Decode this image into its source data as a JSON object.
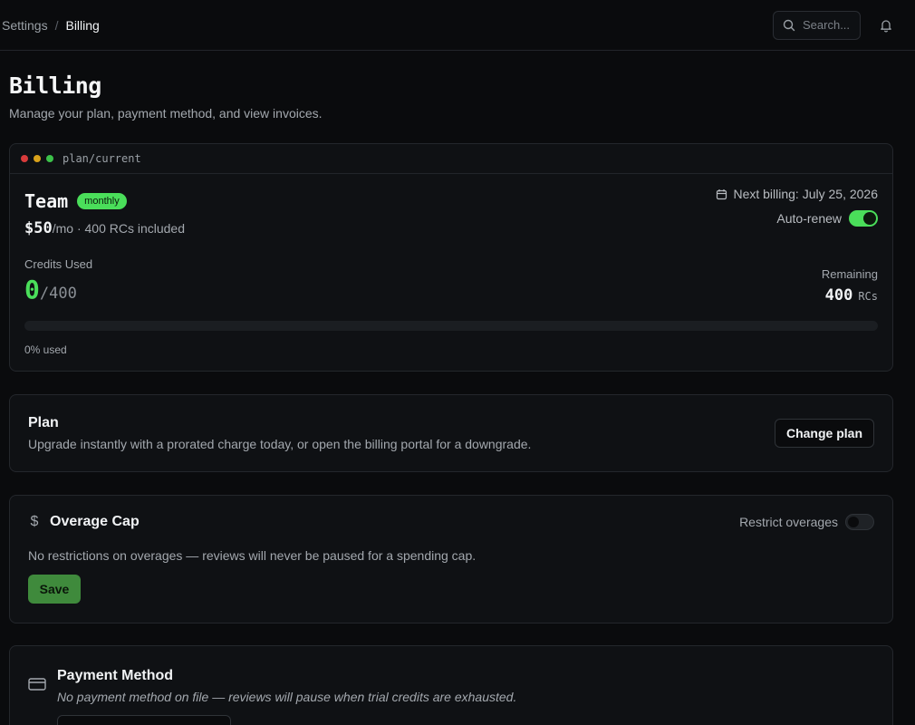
{
  "breadcrumb": {
    "parent": "Settings",
    "separator": "/",
    "current": "Billing"
  },
  "search": {
    "placeholder": "Search..."
  },
  "page": {
    "title": "Billing",
    "subtitle": "Manage your plan, payment method, and view invoices."
  },
  "current_plan": {
    "path": "plan/current",
    "window_dot_colors": [
      "#d83b3b",
      "#d9a21b",
      "#3cc24a"
    ],
    "name": "Team",
    "badge": "monthly",
    "price": "$50",
    "price_suffix": "/mo · 400 RCs included",
    "next_billing": "Next billing: July 25, 2026",
    "auto_renew_label": "Auto-renew",
    "auto_renew_on": true,
    "credits_label": "Credits Used",
    "credits_used": "0",
    "credits_total": "/400",
    "remaining_label": "Remaining",
    "remaining_value": "400",
    "remaining_unit": "RCs",
    "usage_fraction": 0,
    "usage_text": "0% used"
  },
  "plan_section": {
    "title": "Plan",
    "description": "Upgrade instantly with a prorated charge today, or open the billing portal for a downgrade.",
    "button": "Change plan"
  },
  "overage": {
    "icon": "$",
    "title": "Overage Cap",
    "restrict_label": "Restrict overages",
    "restrict_on": false,
    "description": "No restrictions on overages — reviews will never be paused for a spending cap.",
    "save": "Save"
  },
  "payment": {
    "title": "Payment Method",
    "description": "No payment method on file — reviews will pause when trial credits are exhausted."
  },
  "colors": {
    "accent": "#4ade5a",
    "background": "#0a0b0d",
    "card": "#0f1114"
  }
}
